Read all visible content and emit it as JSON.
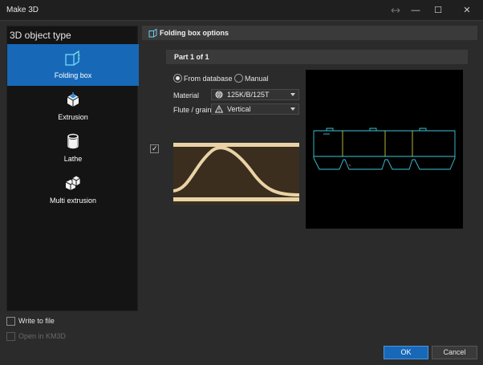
{
  "window": {
    "title": "Make 3D",
    "minimize_glyph": "—",
    "maximize_glyph": "☐",
    "close_glyph": "✕"
  },
  "left": {
    "header": "3D object type",
    "items": [
      {
        "label": "Folding box",
        "icon": "folding-box-icon",
        "selected": true
      },
      {
        "label": "Extrusion",
        "icon": "extrusion-icon",
        "selected": false
      },
      {
        "label": "Lathe",
        "icon": "lathe-icon",
        "selected": false
      },
      {
        "label": "Multi extrusion",
        "icon": "multi-extrusion-icon",
        "selected": false
      }
    ]
  },
  "bottom_checks": {
    "write_to_file": {
      "label": "Write to file",
      "checked": false,
      "enabled": true
    },
    "open_in_km3d": {
      "label": "Open in KM3D",
      "checked": false,
      "enabled": false
    }
  },
  "options": {
    "header": "Folding box options",
    "part_header": "Part 1 of 1",
    "source": {
      "from_database": "From database",
      "manual": "Manual",
      "selected": "From database"
    },
    "material": {
      "label": "Material",
      "value": "125K/B/125T",
      "icon": "globe-icon"
    },
    "flute": {
      "label": "Flute / grain",
      "value": "Vertical",
      "icon": "warning-icon"
    },
    "flute_enabled": true,
    "check_glyph": "✓"
  },
  "buttons": {
    "ok": "OK",
    "cancel": "Cancel"
  },
  "colors": {
    "accent": "#1769b8",
    "preview_cyan": "#3cc6d8",
    "preview_yellow": "#c8c83a",
    "flute_light": "#e9d3a6",
    "flute_dark": "#3b2e1f"
  }
}
